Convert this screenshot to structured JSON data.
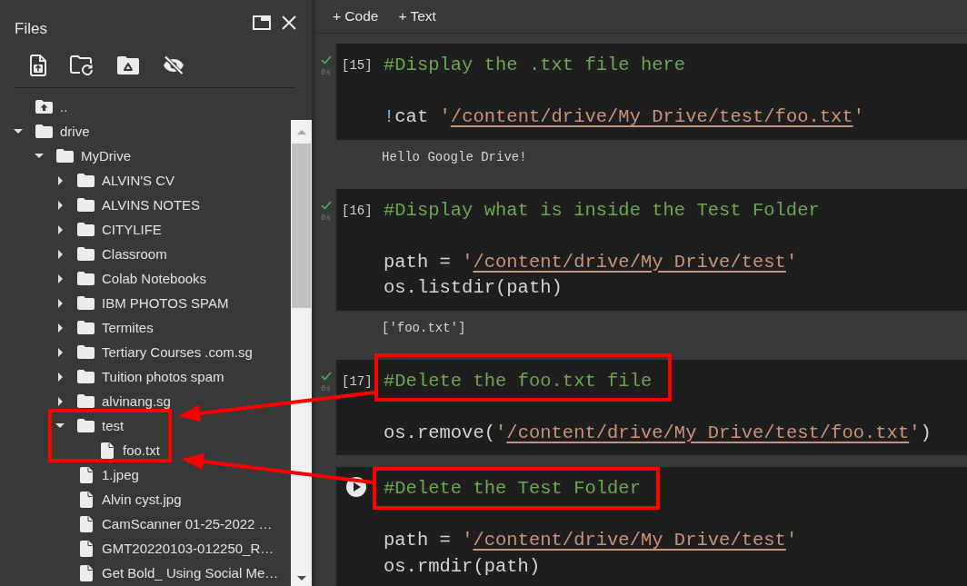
{
  "sidebar": {
    "title": "Files",
    "tree": [
      {
        "kind": "parent",
        "label": ".."
      },
      {
        "kind": "folder",
        "label": "drive",
        "expanded": true,
        "children": [
          {
            "kind": "folder",
            "label": "MyDrive",
            "expanded": true,
            "children": [
              {
                "kind": "folder",
                "label": "ALVIN'S CV",
                "expanded": false
              },
              {
                "kind": "folder",
                "label": "ALVINS NOTES",
                "expanded": false
              },
              {
                "kind": "folder",
                "label": "CITYLIFE",
                "expanded": false
              },
              {
                "kind": "folder",
                "label": "Classroom",
                "expanded": false
              },
              {
                "kind": "folder",
                "label": "Colab Notebooks",
                "expanded": false
              },
              {
                "kind": "folder",
                "label": "IBM PHOTOS SPAM",
                "expanded": false
              },
              {
                "kind": "folder",
                "label": "Termites",
                "expanded": false
              },
              {
                "kind": "folder",
                "label": "Tertiary Courses .com.sg",
                "expanded": false
              },
              {
                "kind": "folder",
                "label": "Tuition photos spam",
                "expanded": false
              },
              {
                "kind": "folder",
                "label": "alvinang.sg",
                "expanded": false
              },
              {
                "kind": "folder",
                "label": "test",
                "expanded": true,
                "children": [
                  {
                    "kind": "file",
                    "label": "foo.txt"
                  }
                ]
              },
              {
                "kind": "file",
                "label": "1.jpeg"
              },
              {
                "kind": "file",
                "label": "Alvin cyst.jpg"
              },
              {
                "kind": "file",
                "label": "CamScanner 01-25-2022 …"
              },
              {
                "kind": "file",
                "label": "GMT20220103-012250_R…"
              },
              {
                "kind": "file",
                "label": "Get Bold_ Using Social Me…"
              }
            ]
          }
        ]
      }
    ]
  },
  "toolbar": [
    {
      "label": "+ Code"
    },
    {
      "label": "+ Text"
    }
  ],
  "cells": [
    {
      "executed": true,
      "execution_count": "[15]",
      "duration": "0s",
      "comment": "#Display the .txt file here",
      "code": [
        {
          "tokens": [
            {
              "kind": "shell",
              "text": "!"
            },
            {
              "kind": "plain",
              "text": "cat "
            },
            {
              "kind": "string",
              "text": "'"
            },
            {
              "kind": "path",
              "text": "/content/drive/My Drive/test/foo.txt"
            },
            {
              "kind": "string",
              "text": "'"
            }
          ]
        }
      ],
      "output": "Hello Google Drive!"
    },
    {
      "executed": true,
      "execution_count": "[16]",
      "duration": "0s",
      "comment": "#Display what is inside the Test Folder",
      "code": [
        {
          "tokens": [
            {
              "kind": "plain",
              "text": "path = "
            },
            {
              "kind": "string",
              "text": "'"
            },
            {
              "kind": "path",
              "text": "/content/drive/My Drive/test"
            },
            {
              "kind": "string",
              "text": "'"
            }
          ]
        },
        {
          "tokens": [
            {
              "kind": "plain",
              "text": "os.listdir(path)"
            }
          ]
        }
      ],
      "output": "['foo.txt']"
    },
    {
      "executed": true,
      "execution_count": "[17]",
      "duration": "0s",
      "comment": "#Delete the foo.txt file",
      "code": [
        {
          "tokens": [
            {
              "kind": "plain",
              "text": "os.remove("
            },
            {
              "kind": "string",
              "text": "'"
            },
            {
              "kind": "path",
              "text": "/content/drive/My Drive/test/foo.txt"
            },
            {
              "kind": "string",
              "text": "'"
            },
            {
              "kind": "plain",
              "text": ")"
            }
          ]
        }
      ]
    },
    {
      "executed": false,
      "comment": "#Delete the Test Folder",
      "code": [
        {
          "tokens": [
            {
              "kind": "plain",
              "text": "path = "
            },
            {
              "kind": "string",
              "text": "'"
            },
            {
              "kind": "path",
              "text": "/content/drive/My Drive/test"
            },
            {
              "kind": "string",
              "text": "'"
            }
          ]
        },
        {
          "tokens": [
            {
              "kind": "plain",
              "text": "os.rmdir(path)"
            }
          ]
        }
      ]
    }
  ]
}
